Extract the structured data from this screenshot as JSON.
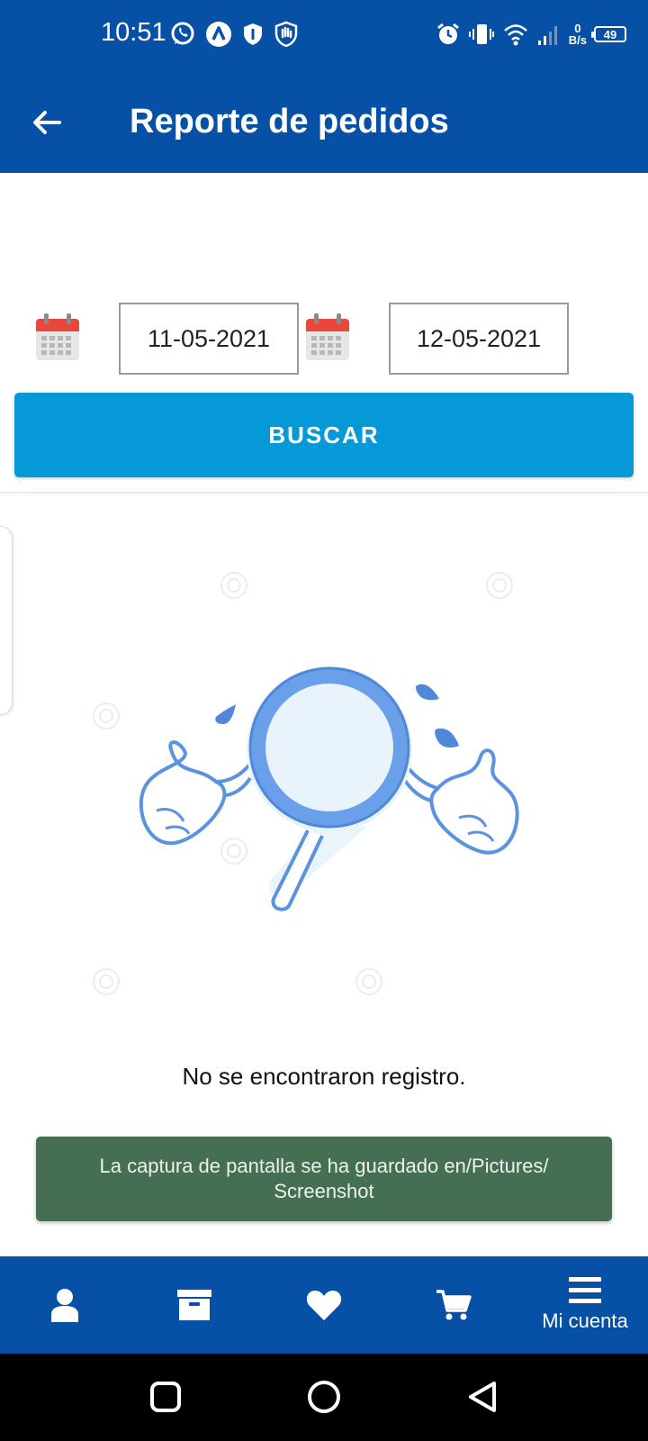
{
  "status_bar": {
    "time": "10:51",
    "left_icons": [
      "whatsapp-icon",
      "app-a-icon",
      "shield-icon",
      "hand-shield-icon"
    ],
    "right_icons": [
      "alarm-icon",
      "vibrate-icon",
      "wifi-icon",
      "signal-icon"
    ],
    "speed_value": "0",
    "speed_unit": "B/s",
    "battery": "49"
  },
  "app_bar": {
    "title": "Reporte de pedidos",
    "back_icon": "arrow-left-icon"
  },
  "filter": {
    "date_from": "11-05-2021",
    "date_to": "12-05-2021",
    "calendar_icon": "calendar-icon",
    "search_label": "BUSCAR"
  },
  "empty_state": {
    "illustration": "magnifier-shrug-illustration",
    "message": "No se encontraron registro."
  },
  "toast": {
    "message": "La captura de pantalla se ha guardado en/Pictures/ Screenshot"
  },
  "bottom_nav": {
    "items": [
      {
        "icon": "user-icon"
      },
      {
        "icon": "archive-box-icon"
      },
      {
        "icon": "heart-icon"
      },
      {
        "icon": "cart-icon"
      },
      {
        "icon": "menu-icon",
        "label": "Mi cuenta"
      }
    ]
  },
  "colors": {
    "primary": "#0651a6",
    "button": "#059ad7",
    "toast": "#456e52"
  }
}
